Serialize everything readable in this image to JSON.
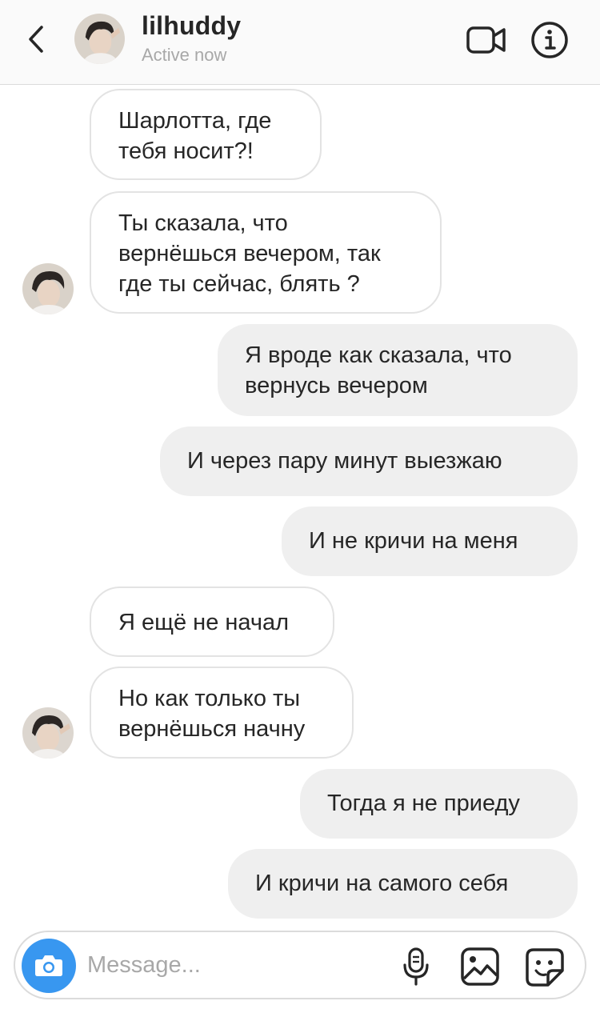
{
  "header": {
    "username": "lilhuddy",
    "status": "Active now",
    "icons": [
      "back-chevron-icon",
      "video-call-icon",
      "info-icon"
    ]
  },
  "messages": [
    {
      "direction": "incoming",
      "text": "Шарлотта, где\nтебя носит?!"
    },
    {
      "direction": "incoming",
      "text": "Ты сказала, что\nвернёшься вечером, так\nгде ты сейчас, блять ?"
    },
    {
      "direction": "outgoing",
      "text": "Я вроде как сказала, что\nвернусь вечером"
    },
    {
      "direction": "outgoing",
      "text": "И через пару минут выезжаю"
    },
    {
      "direction": "outgoing",
      "text": "И не кричи на меня"
    },
    {
      "direction": "incoming",
      "text": "Я ещё не начал"
    },
    {
      "direction": "incoming",
      "text": "Но как только ты\nвернёшься начну"
    },
    {
      "direction": "outgoing",
      "text": "Тогда я не приеду"
    },
    {
      "direction": "outgoing",
      "text": "И кричи на самого себя"
    }
  ],
  "composer": {
    "placeholder": "Message...",
    "icons": [
      "camera-icon",
      "microphone-icon",
      "gallery-icon",
      "sticker-icon"
    ]
  },
  "colors": {
    "accent": "#3897f0",
    "outgoing_bubble": "#efefef",
    "incoming_border": "#e3e3e3",
    "secondary_text": "#a8a8a8"
  }
}
